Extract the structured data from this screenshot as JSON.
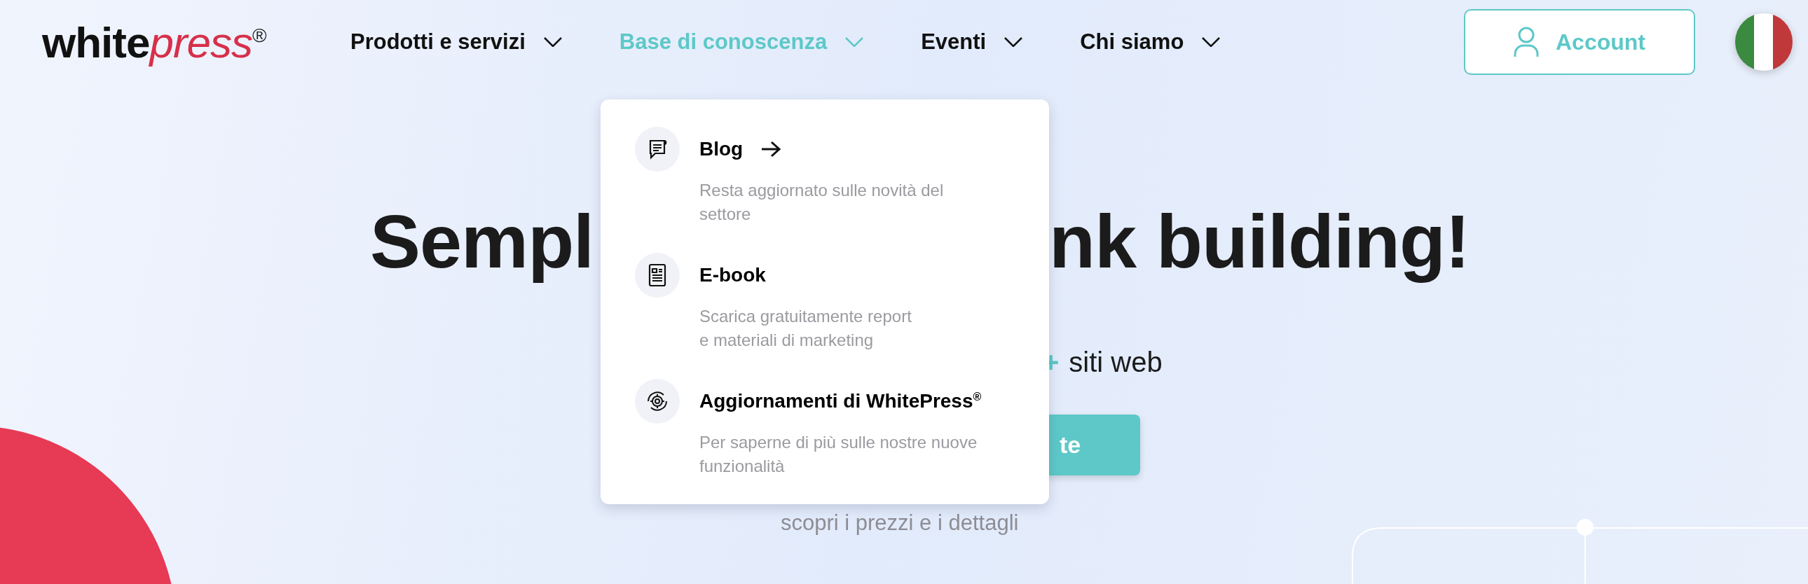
{
  "logo": {
    "text": "white",
    "accent": "press",
    "mark": "®"
  },
  "nav": [
    {
      "label": "Prodotti e servizi",
      "selected": false
    },
    {
      "label": "Base di conoscenza",
      "selected": true
    },
    {
      "label": "Eventi",
      "selected": false
    },
    {
      "label": "Chi siamo",
      "selected": false
    }
  ],
  "account_button": {
    "label": "Account"
  },
  "hero": {
    "title_parts": [
      "Sempl",
      "nk building!"
    ],
    "subtitle_accent": "+",
    "subtitle": "siti web",
    "cta_button": "te",
    "link": "scopri i prezzi e i dettagli"
  },
  "dropdown": {
    "items": [
      {
        "kind": "blog",
        "title": "Blog",
        "has_arrow": true,
        "description": "Resta aggiornato sulle novità del\nsettore"
      },
      {
        "kind": "ebook",
        "title": "E-book",
        "has_arrow": false,
        "description": "Scarica gratuitamente report\ne materiali di marketing"
      },
      {
        "kind": "updates",
        "title": "Aggiornamenti di WhitePress$^{®}$",
        "has_arrow": false,
        "description": "Per saperne di più sulle nostre nuove\nfunzionalità"
      }
    ]
  }
}
